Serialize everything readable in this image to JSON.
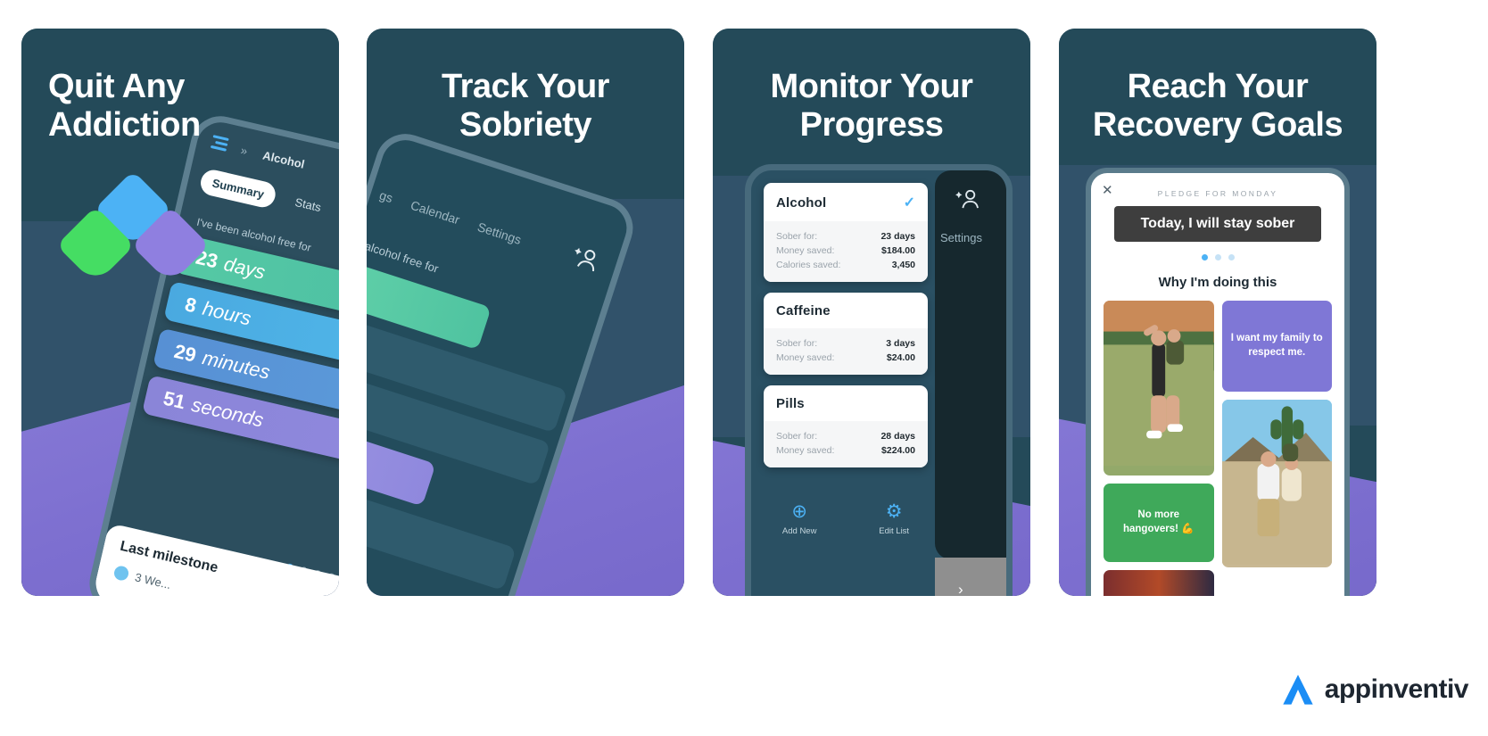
{
  "brand": {
    "name": "appinventiv",
    "logo_icon": "appinventiv-a-mark",
    "accent": "#1b8df5"
  },
  "panels": [
    {
      "id": "panel-quit-any-addiction",
      "title": "Quit Any\nAddiction",
      "logo_icons": [
        "diamond-blue-icon",
        "diamond-green-icon",
        "diamond-purple-icon"
      ],
      "phone": {
        "menu_icon": "hamburger-icon",
        "chevron_icon": "chevron-right-icon",
        "breadcrumb": "Alcohol",
        "tabs": [
          "Summary",
          "Stats"
        ],
        "active_tab": "Summary",
        "subtitle": "I've been alcohol free for",
        "counters": [
          {
            "value": "23",
            "unit": "days",
            "color": "#55c9a4"
          },
          {
            "value": "8",
            "unit": "hours",
            "color": "#4aa9e0"
          },
          {
            "value": "29",
            "unit": "minutes",
            "color": "#5790d4"
          },
          {
            "value": "51",
            "unit": "seconds",
            "color": "#8a85d8"
          }
        ],
        "pagination_dots": 4,
        "pagination_active": 1,
        "sheet_title": "Last milestone",
        "sheet_item": "3 We..."
      }
    },
    {
      "id": "panel-track-your-sobriety",
      "title": "Track Your\nSobriety",
      "phone": {
        "nav": [
          "gs",
          "Calendar",
          "Settings"
        ],
        "person_icon": "person-add-icon",
        "subtitle": "alcohol free for"
      }
    },
    {
      "id": "panel-monitor-your-progress",
      "title": "Monitor Your\nProgress",
      "phone": {
        "person_icon": "person-add-icon",
        "side_label": "Settings",
        "arrow_icon": "chevron-right-icon",
        "cards": [
          {
            "name": "Alcohol",
            "check_icon": "check-icon",
            "checked": true,
            "rows": [
              {
                "label": "Sober for:",
                "value": "23 days"
              },
              {
                "label": "Money saved:",
                "value": "$184.00"
              },
              {
                "label": "Calories saved:",
                "value": "3,450"
              }
            ]
          },
          {
            "name": "Caffeine",
            "checked": false,
            "rows": [
              {
                "label": "Sober for:",
                "value": "3 days"
              },
              {
                "label": "Money saved:",
                "value": "$24.00"
              }
            ]
          },
          {
            "name": "Pills",
            "checked": false,
            "rows": [
              {
                "label": "Sober for:",
                "value": "28 days"
              },
              {
                "label": "Money saved:",
                "value": "$224.00"
              }
            ]
          }
        ],
        "actions": [
          {
            "label": "Add New",
            "icon": "plus-circle-icon"
          },
          {
            "label": "Edit List",
            "icon": "gear-icon"
          }
        ]
      }
    },
    {
      "id": "panel-reach-your-recovery-goals",
      "title": "Reach Your\nRecovery Goals",
      "phone": {
        "close_icon": "close-icon",
        "kicker": "PLEDGE FOR MONDAY",
        "banner": "Today, I will stay sober",
        "pagination_dots": 3,
        "pagination_active": 1,
        "section_title": "Why I'm doing this",
        "tiles": [
          {
            "type": "photo",
            "name": "photo-mother-kissing-child"
          },
          {
            "type": "quote",
            "text": "I want my family to respect me.",
            "color": "#7f77d6"
          },
          {
            "type": "quote",
            "text": "No more hangovers! 💪",
            "color": "#3fa95a"
          },
          {
            "type": "photo",
            "name": "photo-family-in-desert"
          },
          {
            "type": "photo",
            "name": "photo-concert-crowd"
          }
        ]
      }
    }
  ]
}
